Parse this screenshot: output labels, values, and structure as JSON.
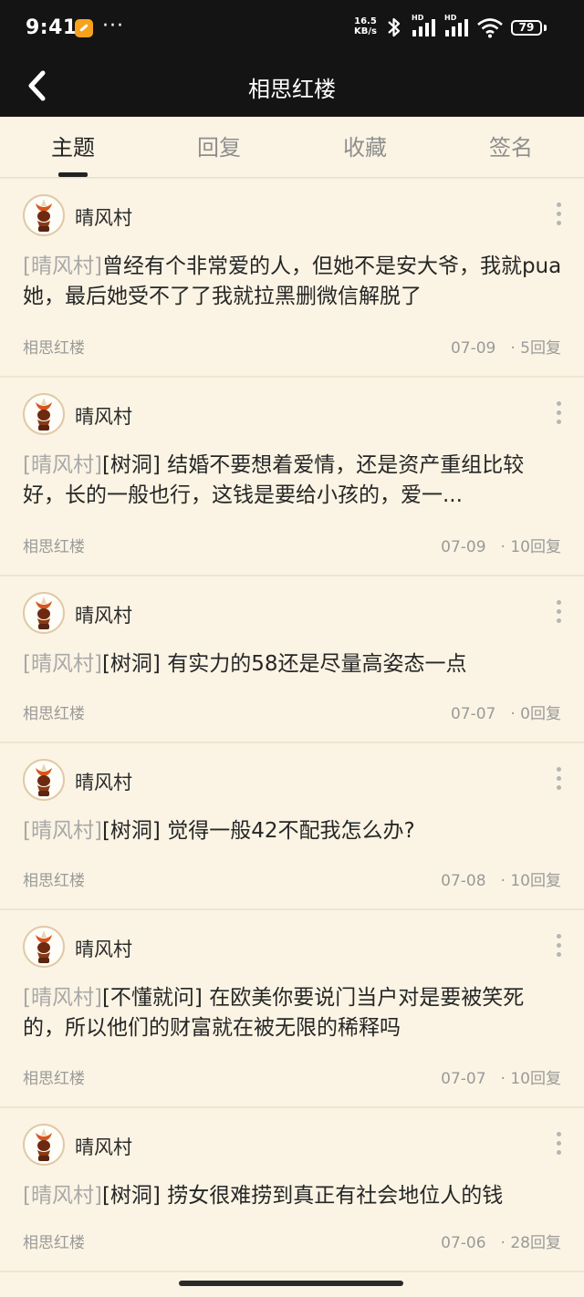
{
  "status_bar": {
    "time": "9:41",
    "more": "···",
    "net_speed_value": "16.5",
    "net_speed_unit": "KB/s",
    "hd1": "HD",
    "hd2": "HD",
    "battery": "79"
  },
  "header": {
    "title": "相思红楼"
  },
  "tabs": [
    {
      "label": "主题",
      "active": true
    },
    {
      "label": "回复"
    },
    {
      "label": "收藏"
    },
    {
      "label": "签名"
    }
  ],
  "posts": [
    {
      "user": "晴风村",
      "prefix": "[晴风村]",
      "text": "曾经有个非常爱的人，但她不是安大爷，我就pua她，最后她受不了了我就拉黑删微信解脱了",
      "forum": "相思红楼",
      "date": "07-09",
      "replies": "· 5回复"
    },
    {
      "user": "晴风村",
      "prefix": "[晴风村]",
      "text": "[树洞] 结婚不要想着爱情，还是资产重组比较好，长的一般也行，这钱是要给小孩的，爱一...",
      "forum": "相思红楼",
      "date": "07-09",
      "replies": "· 10回复"
    },
    {
      "user": "晴风村",
      "prefix": "[晴风村]",
      "text": "[树洞] 有实力的58还是尽量高姿态一点",
      "forum": "相思红楼",
      "date": "07-07",
      "replies": "· 0回复"
    },
    {
      "user": "晴风村",
      "prefix": "[晴风村]",
      "text": "[树洞] 觉得一般42不配我怎么办?",
      "forum": "相思红楼",
      "date": "07-08",
      "replies": "· 10回复"
    },
    {
      "user": "晴风村",
      "prefix": "[晴风村]",
      "text": "[不懂就问] 在欧美你要说门当户对是要被笑死的，所以他们的财富就在被无限的稀释吗",
      "forum": "相思红楼",
      "date": "07-07",
      "replies": "· 10回复"
    },
    {
      "user": "晴风村",
      "prefix": "[晴风村]",
      "text": "[树洞] 捞女很难捞到真正有社会地位人的钱",
      "forum": "相思红楼",
      "date": "07-06",
      "replies": "· 28回复"
    }
  ],
  "icons": {
    "back": "chevron-left-icon",
    "more": "vertical-dots-icon",
    "avatar": "avatar"
  },
  "colors": {
    "header_bg": "#141414",
    "page_bg": "#fbf4e4",
    "active_tab": "#222222",
    "inactive_tab": "#8e8e8e",
    "prefix": "#a8a8a8"
  }
}
